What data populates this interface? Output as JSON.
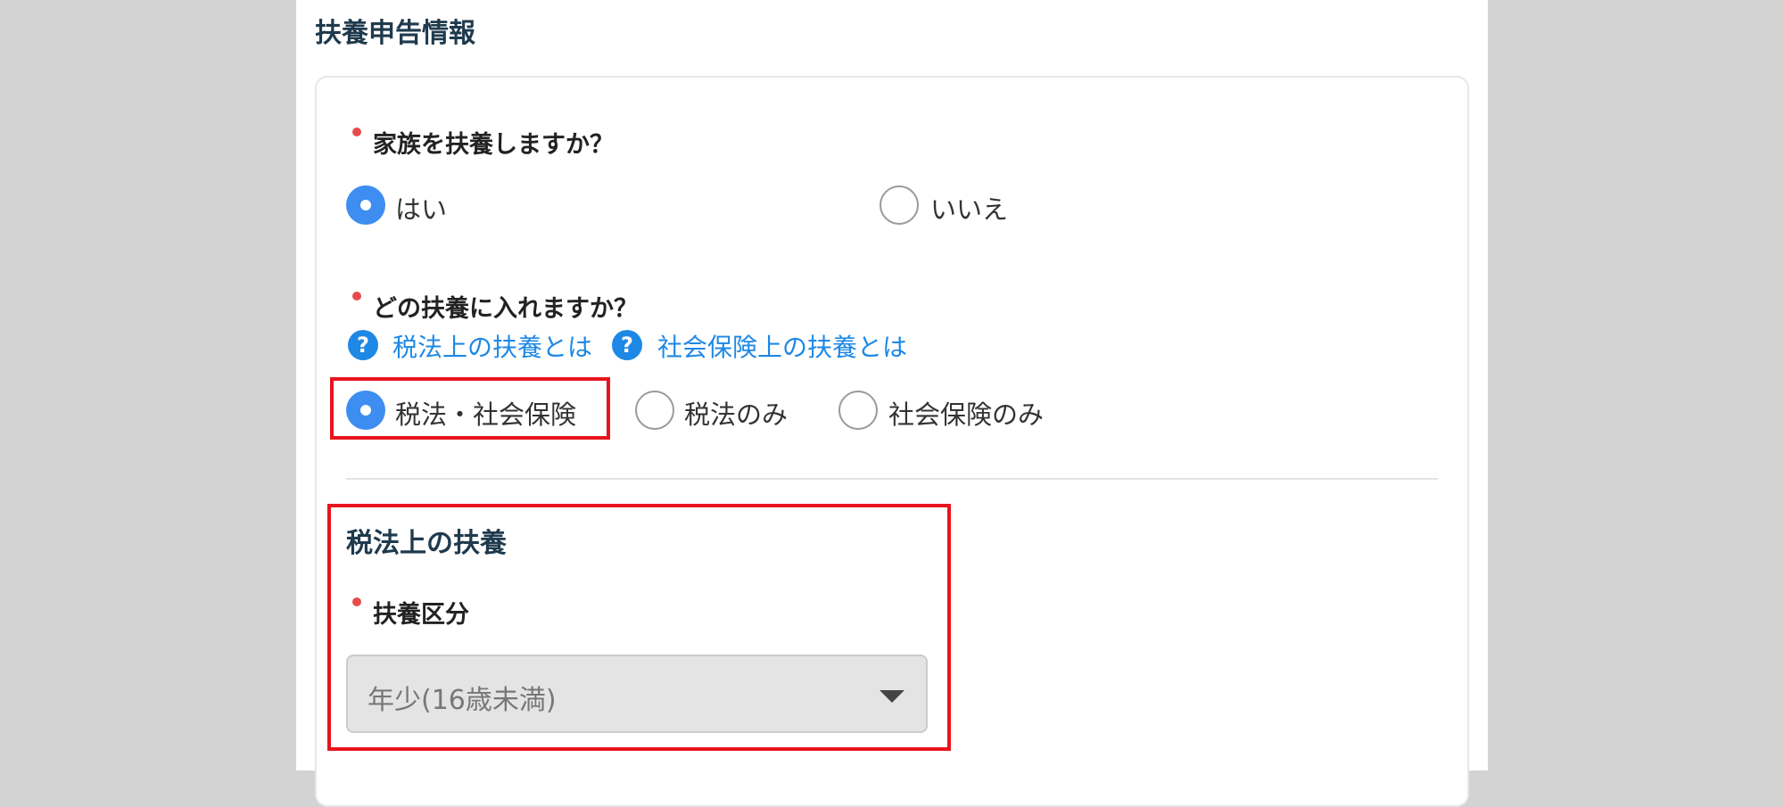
{
  "section": {
    "title": "扶養申告情報"
  },
  "question1": {
    "label": "家族を扶養しますか？",
    "options": [
      {
        "label": "はい",
        "checked": true
      },
      {
        "label": "いいえ",
        "checked": false
      }
    ]
  },
  "question2": {
    "label": "どの扶養に入れますか？",
    "help_links": [
      {
        "icon": "question-icon",
        "label": "税法上の扶養とは"
      },
      {
        "icon": "question-icon",
        "label": "社会保険上の扶養とは"
      }
    ],
    "options": [
      {
        "label": "税法・社会保険",
        "checked": true
      },
      {
        "label": "税法のみ",
        "checked": false
      },
      {
        "label": "社会保険のみ",
        "checked": false
      }
    ]
  },
  "tax_dependent": {
    "title": "税法上の扶養",
    "category_label": "扶養区分",
    "category_value": "年少(16歳未満)"
  },
  "colors": {
    "accent": "#3d8ef0",
    "link": "#1e88e5",
    "required": "#e84b4b",
    "highlight": "#e8141e"
  }
}
